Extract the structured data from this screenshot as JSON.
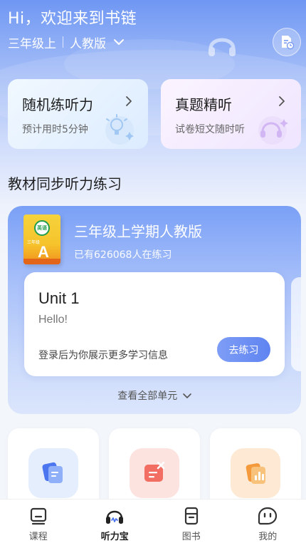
{
  "header": {
    "greeting": "Hi，欢迎来到书链",
    "grade": "三年级上",
    "edition": "人教版"
  },
  "quick_cards": [
    {
      "title": "随机练听力",
      "subtitle": "预计用时5分钟"
    },
    {
      "title": "真题精听",
      "subtitle": "试卷短文随时听"
    }
  ],
  "section": {
    "title": "教材同步听力练习"
  },
  "book": {
    "cover_badge": "英语",
    "cover_grade": "三年级",
    "cover_letter": "A",
    "title": "三年级上学期人教版",
    "count_text": "已有626068人在练习"
  },
  "unit": {
    "name": "Unit 1",
    "subtitle": "Hello!",
    "note": "登录后为你展示更多学习信息",
    "button": "去练习"
  },
  "view_all": "查看全部单元",
  "tools": [
    {
      "icon": "document-icon",
      "color": "#5b86f5"
    },
    {
      "icon": "wrong-answers-icon",
      "color": "#f26d62"
    },
    {
      "icon": "report-icon",
      "color": "#f7a44a"
    }
  ],
  "tabs": [
    {
      "label": "课程",
      "icon": "course-icon",
      "active": false
    },
    {
      "label": "听力宝",
      "icon": "headphones-icon",
      "active": true
    },
    {
      "label": "图书",
      "icon": "book-icon",
      "active": false
    },
    {
      "label": "我的",
      "icon": "profile-icon",
      "active": false
    }
  ]
}
